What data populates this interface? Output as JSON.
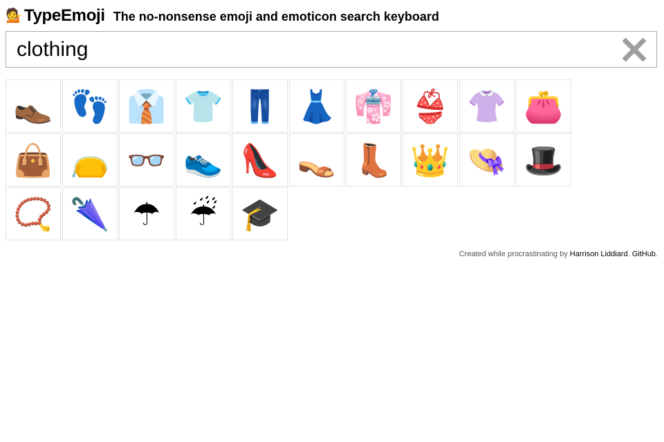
{
  "header": {
    "logo_icon": "💁",
    "title": "TypeEmoji",
    "tagline": "The no-nonsense emoji and emoticon search keyboard"
  },
  "search": {
    "value": "clothing",
    "clear_icon": "close-icon"
  },
  "results": [
    {
      "emoji": "👞",
      "name": "mans-shoe"
    },
    {
      "emoji": "👣",
      "name": "footprints"
    },
    {
      "emoji": "👔",
      "name": "necktie"
    },
    {
      "emoji": "👕",
      "name": "t-shirt"
    },
    {
      "emoji": "👖",
      "name": "jeans"
    },
    {
      "emoji": "👗",
      "name": "dress"
    },
    {
      "emoji": "👘",
      "name": "kimono"
    },
    {
      "emoji": "👙",
      "name": "bikini"
    },
    {
      "emoji": "👚",
      "name": "womans-clothes"
    },
    {
      "emoji": "👛",
      "name": "purse"
    },
    {
      "emoji": "👜",
      "name": "handbag"
    },
    {
      "emoji": "👝",
      "name": "pouch"
    },
    {
      "emoji": "👓",
      "name": "eyeglasses"
    },
    {
      "emoji": "👟",
      "name": "athletic-shoe"
    },
    {
      "emoji": "👠",
      "name": "high-heeled-shoe"
    },
    {
      "emoji": "👡",
      "name": "womans-sandal"
    },
    {
      "emoji": "👢",
      "name": "womans-boots"
    },
    {
      "emoji": "👑",
      "name": "crown"
    },
    {
      "emoji": "👒",
      "name": "womans-hat"
    },
    {
      "emoji": "🎩",
      "name": "top-hat"
    },
    {
      "emoji": "📿",
      "name": "prayer-beads"
    },
    {
      "emoji": "🌂",
      "name": "closed-umbrella"
    },
    {
      "emoji": "☂",
      "name": "umbrella"
    },
    {
      "emoji": "☔",
      "name": "umbrella-with-rain-drops"
    },
    {
      "emoji": "🎓",
      "name": "graduation-cap"
    }
  ],
  "footer": {
    "prefix": "Created while procrastinating by ",
    "author_link": "Harrison Liddiard",
    "separator": ". ",
    "github_link": "GitHub",
    "suffix": "."
  },
  "colors": {
    "clear_icon": "#9e9e9e",
    "cell_border": "#e3e3e3",
    "search_border": "#a9a9a9"
  }
}
